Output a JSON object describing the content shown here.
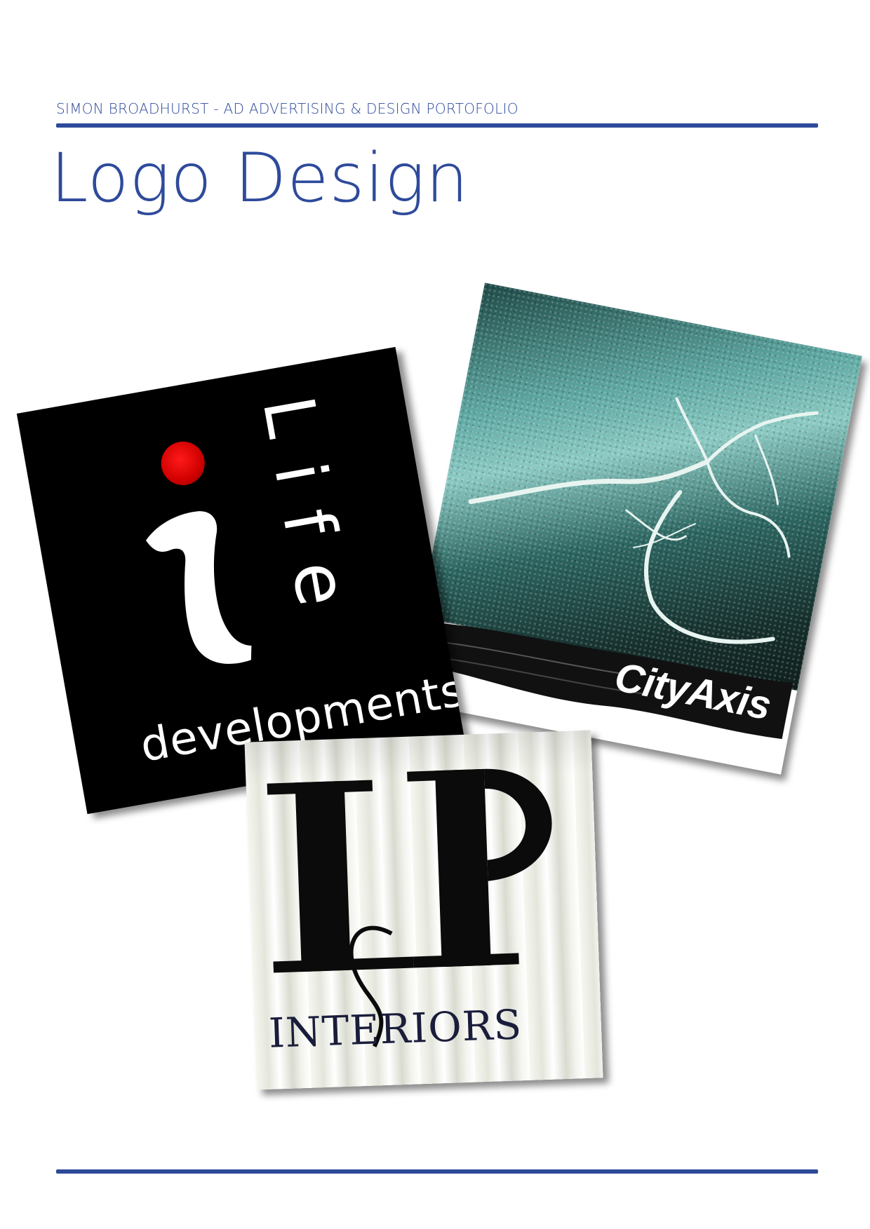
{
  "header": {
    "text": "SIMON BROADHURST - AD ADVERTISING & DESIGN PORTOFOLIO"
  },
  "page": {
    "title": "Logo Design"
  },
  "logos": {
    "life": {
      "word_top": "Life",
      "word_bottom": "developments",
      "letter": "i"
    },
    "cityaxis": {
      "word": "CityAxis"
    },
    "lp": {
      "letters": "LP",
      "letter_c": "c",
      "word": "INTERIORS"
    }
  },
  "colors": {
    "brand_blue": "#2e4a9b",
    "life_red": "#d00000"
  }
}
